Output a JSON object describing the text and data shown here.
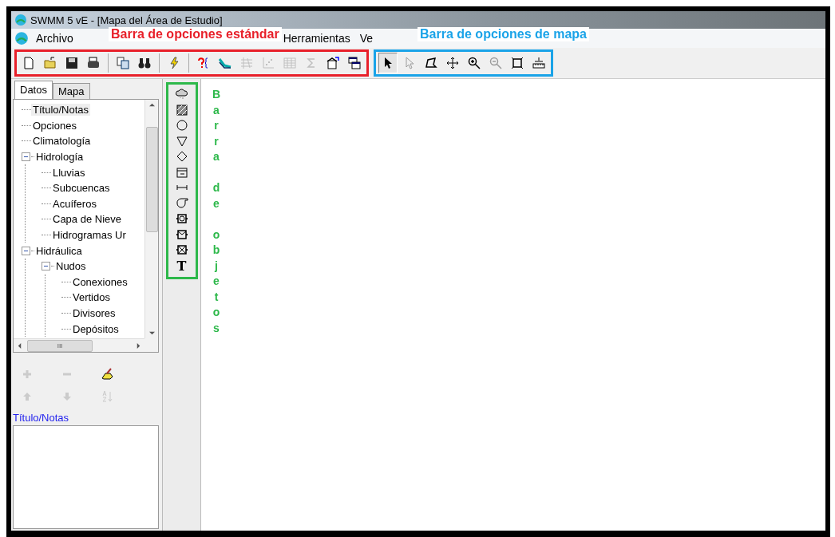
{
  "window": {
    "title": "SWMM 5 vE - [Mapa del Área de Estudio]"
  },
  "menu": [
    {
      "label": "Archivo"
    },
    {
      "label": "Herramientas"
    },
    {
      "label": "Ve"
    }
  ],
  "annotations": [
    {
      "text": "Barra de opciones estándar",
      "color": "#e8202a"
    },
    {
      "text": "Barra de opciones de mapa",
      "color": "#1aa3e8"
    },
    {
      "text": "Barra de objetos",
      "color": "#2db84a"
    }
  ],
  "standard_toolbar": [
    {
      "disabled": false
    },
    {
      "disabled": false
    },
    {
      "disabled": false
    },
    {
      "disabled": false
    },
    {
      "disabled": false
    },
    {
      "disabled": false
    },
    {
      "disabled": false
    },
    {
      "disabled": false
    },
    {
      "disabled": false
    },
    {
      "disabled": true
    },
    {
      "disabled": true
    },
    {
      "disabled": true
    },
    {
      "disabled": true
    },
    {
      "disabled": false
    },
    {
      "disabled": false
    }
  ],
  "map_toolbar": [
    {
      "selected": true,
      "disabled": false
    },
    {
      "selected": false,
      "disabled": true
    },
    {
      "selected": false,
      "disabled": false
    },
    {
      "selected": false,
      "disabled": false
    },
    {
      "selected": false,
      "disabled": false
    },
    {
      "selected": false,
      "disabled": true
    },
    {
      "selected": false,
      "disabled": false
    },
    {
      "selected": false,
      "disabled": false
    }
  ],
  "tabs": [
    {
      "label": "Datos",
      "selected": true
    },
    {
      "label": "Mapa",
      "selected": false
    }
  ],
  "tree": [
    {
      "label": "Título/Notas",
      "selected": true
    },
    {
      "label": "Opciones",
      "selected": false
    },
    {
      "label": "Climatología",
      "selected": false
    },
    {
      "label": "Hidrología",
      "selected": false,
      "expanded": true,
      "children": [
        {
          "label": "Lluvias",
          "selected": false
        },
        {
          "label": "Subcuencas",
          "selected": false
        },
        {
          "label": "Acuíferos",
          "selected": false
        },
        {
          "label": "Capa de Nieve",
          "selected": false
        },
        {
          "label": "Hidrogramas Ur",
          "selected": false
        }
      ]
    },
    {
      "label": "Hidráulica",
      "selected": false,
      "expanded": true,
      "children": [
        {
          "label": "Nudos",
          "selected": false,
          "expanded": true,
          "children": [
            {
              "label": "Conexiones",
              "selected": false
            },
            {
              "label": "Vertidos",
              "selected": false
            },
            {
              "label": "Divisores",
              "selected": false
            },
            {
              "label": "Depósitos",
              "selected": false
            }
          ]
        }
      ]
    }
  ],
  "hscroll_grip": "III",
  "object_toolbar": {
    "text_tool": "T"
  },
  "selected_item_label": "Título/Notas"
}
